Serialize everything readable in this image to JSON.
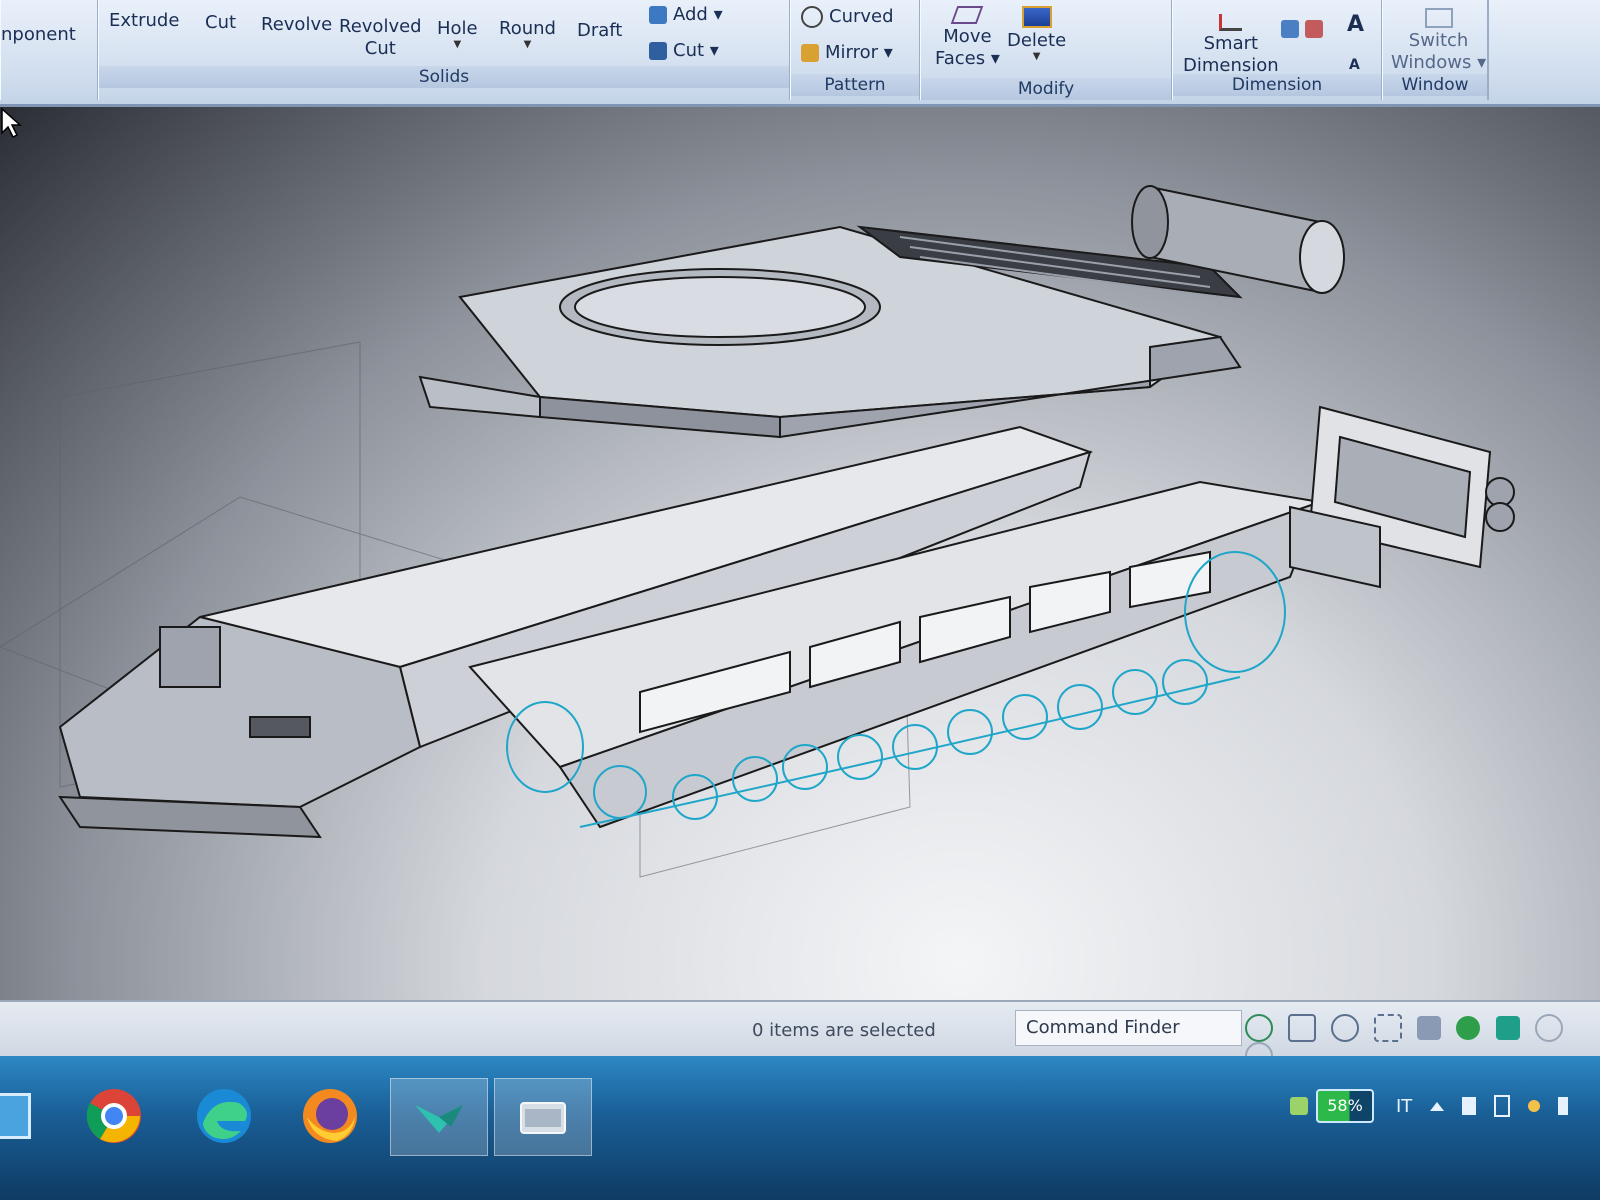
{
  "ribbon": {
    "component_partial": "nponent",
    "solids": {
      "label": "Solids",
      "extrude": "Extrude",
      "cut": "Cut",
      "revolve": "Revolve",
      "revolved_cut_l1": "Revolved",
      "revolved_cut_l2": "Cut",
      "hole": "Hole",
      "round": "Round",
      "draft": "Draft",
      "add": "Add",
      "cut_small": "Cut"
    },
    "pattern": {
      "label": "Pattern",
      "curved": "Curved",
      "mirror": "Mirror"
    },
    "modify": {
      "label": "Modify",
      "move_faces_l1": "Move",
      "move_faces_l2": "Faces",
      "delete": "Delete"
    },
    "dimension": {
      "label": "Dimension",
      "smart_l1": "Smart",
      "smart_l2": "Dimension",
      "text_a": "A",
      "text_a_small": "A"
    },
    "window": {
      "label": "Window",
      "switch_l1": "Switch",
      "switch_l2": "Windows"
    }
  },
  "status": {
    "selection": "0 items are selected",
    "command_finder": "Command Finder"
  },
  "tray": {
    "battery": "58%",
    "language": "IT"
  },
  "colors": {
    "sketch": "#1fa6c9",
    "model_edge": "#1a1a1a",
    "model_face": "#c9ccd3",
    "ribbon_text": "#1b2f55"
  }
}
